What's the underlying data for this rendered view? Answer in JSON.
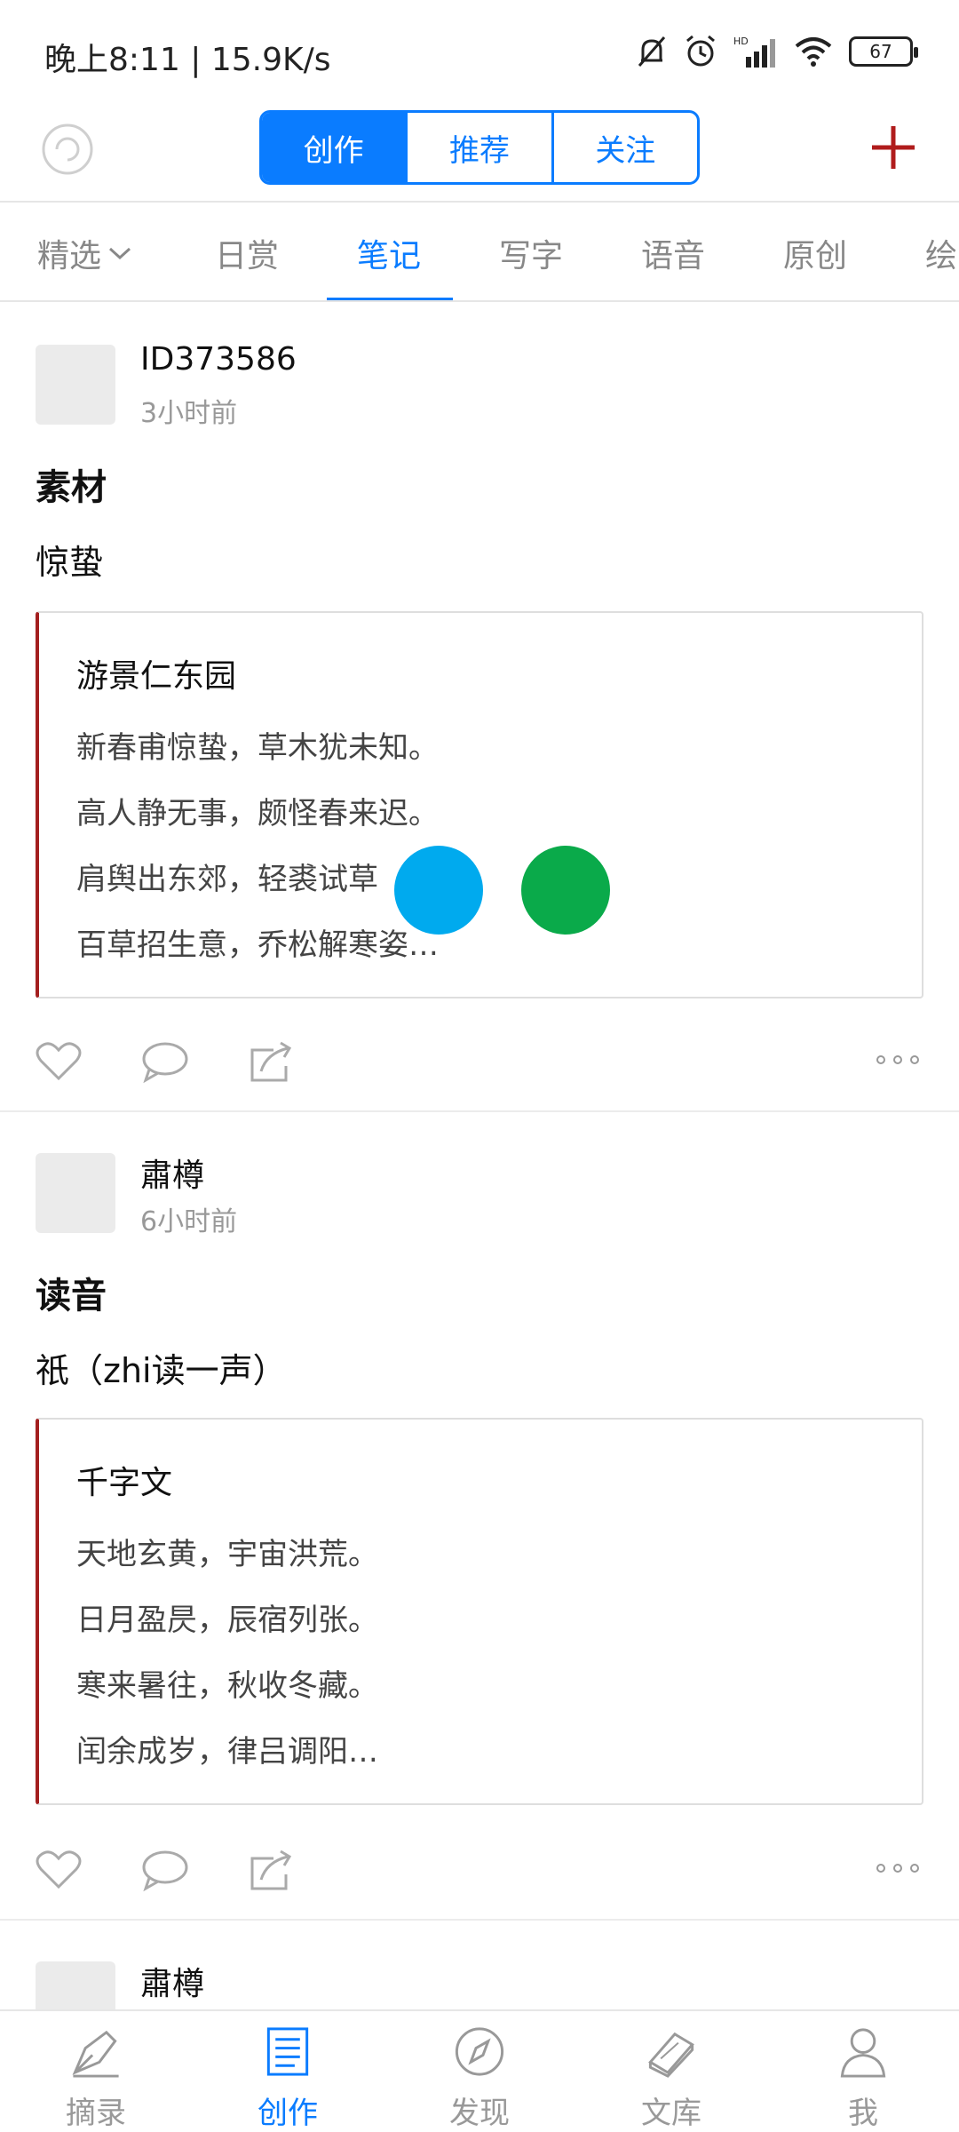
{
  "status_bar": {
    "time_speed": "晚上8:11 | 15.9K/s",
    "battery": "67"
  },
  "top_bar": {
    "segments": [
      {
        "label": "创作",
        "active": true
      },
      {
        "label": "推荐",
        "active": false
      },
      {
        "label": "关注",
        "active": false
      }
    ]
  },
  "categories": [
    {
      "label": "精选",
      "active": false,
      "has_dropdown": true
    },
    {
      "label": "日赏",
      "active": false
    },
    {
      "label": "笔记",
      "active": true
    },
    {
      "label": "写字",
      "active": false
    },
    {
      "label": "语音",
      "active": false
    },
    {
      "label": "原创",
      "active": false
    },
    {
      "label": "绘",
      "active": false
    }
  ],
  "posts": [
    {
      "author": "ID373586",
      "time": "3小时前",
      "title": "素材",
      "subtitle": "惊蛰",
      "quote_title": "游景仁东园",
      "quote_lines": [
        "新春甫惊蛰，草木犹未知。",
        "高人静无事，颇怪春来迟。",
        "肩舆出东郊，轻裘试草",
        "百草招生意，乔松解寒姿…"
      ]
    },
    {
      "author": "肅樽",
      "time": "6小时前",
      "title": "读音",
      "subtitle": "祇（zhi读一声）",
      "quote_title": "千字文",
      "quote_lines": [
        "天地玄黄，宇宙洪荒。",
        "日月盈昃，辰宿列张。",
        "寒来暑往，秋收冬藏。",
        "闰余成岁，律吕调阳…"
      ]
    },
    {
      "author": "肅樽"
    }
  ],
  "bottom_nav": [
    {
      "label": "摘录",
      "icon": "pen-icon",
      "active": false
    },
    {
      "label": "创作",
      "icon": "document-icon",
      "active": true
    },
    {
      "label": "发现",
      "icon": "compass-icon",
      "active": false
    },
    {
      "label": "文库",
      "icon": "books-icon",
      "active": false
    },
    {
      "label": "我",
      "icon": "person-icon",
      "active": false
    }
  ],
  "colors": {
    "accent": "#0a7cff",
    "add": "#b01c1c",
    "quote_border": "#a31f1f",
    "dot_blue": "#00aaee",
    "dot_green": "#0aaa4a"
  }
}
